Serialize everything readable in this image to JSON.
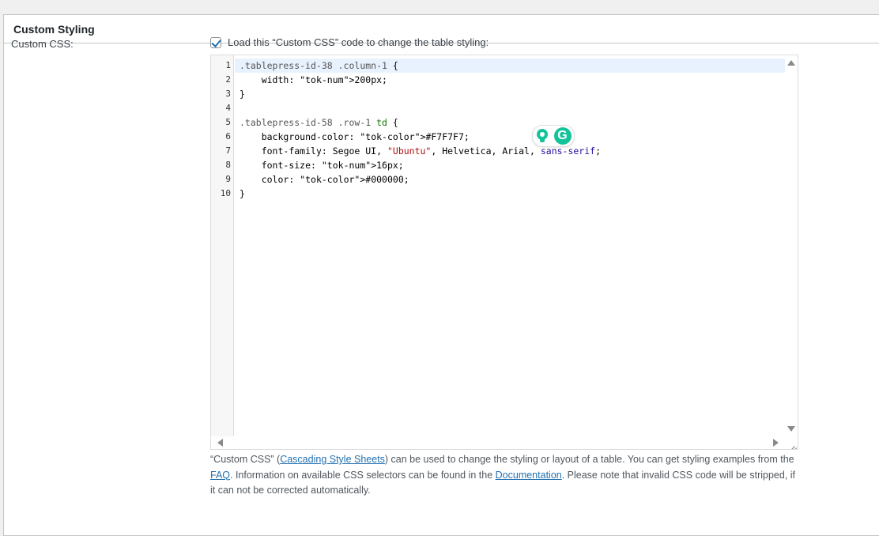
{
  "section": {
    "title": "Custom Styling"
  },
  "field": {
    "label": "Custom CSS:",
    "checkbox_checked": true,
    "checkbox_label": "Load this “Custom CSS” code to change the table styling:"
  },
  "editor": {
    "line_numbers": [
      "1",
      "2",
      "3",
      "4",
      "5",
      "6",
      "7",
      "8",
      "9",
      "10"
    ],
    "lines": [
      ".tablepress-id-38 .column-1 {",
      "    width: 200px;",
      "}",
      "",
      ".tablepress-id-58 .row-1 td {",
      "    background-color: #F7F7F7;",
      "    font-family: Segoe UI, \"Ubuntu\", Helvetica, Arial, sans-serif;",
      "    font-size: 16px;",
      "    color: #000000;",
      "}"
    ],
    "active_line": 1
  },
  "description": {
    "part1": "“Custom CSS” (",
    "link1": "Cascading Style Sheets",
    "part2": ") can be used to change the styling or layout of a table. You can get styling examples from the ",
    "link2": "FAQ",
    "part3": ". Information on available CSS selectors can be found in the ",
    "link3": "Documentation",
    "part4": ". Please note that invalid CSS code will be stripped, if it can not be corrected automatically."
  },
  "icons": {
    "bulb": "lightbulb-icon",
    "grammarly": "grammarly-icon",
    "g_letter": "G"
  },
  "colors": {
    "accent": "#2271b1",
    "grammarly": "#15c39a"
  }
}
